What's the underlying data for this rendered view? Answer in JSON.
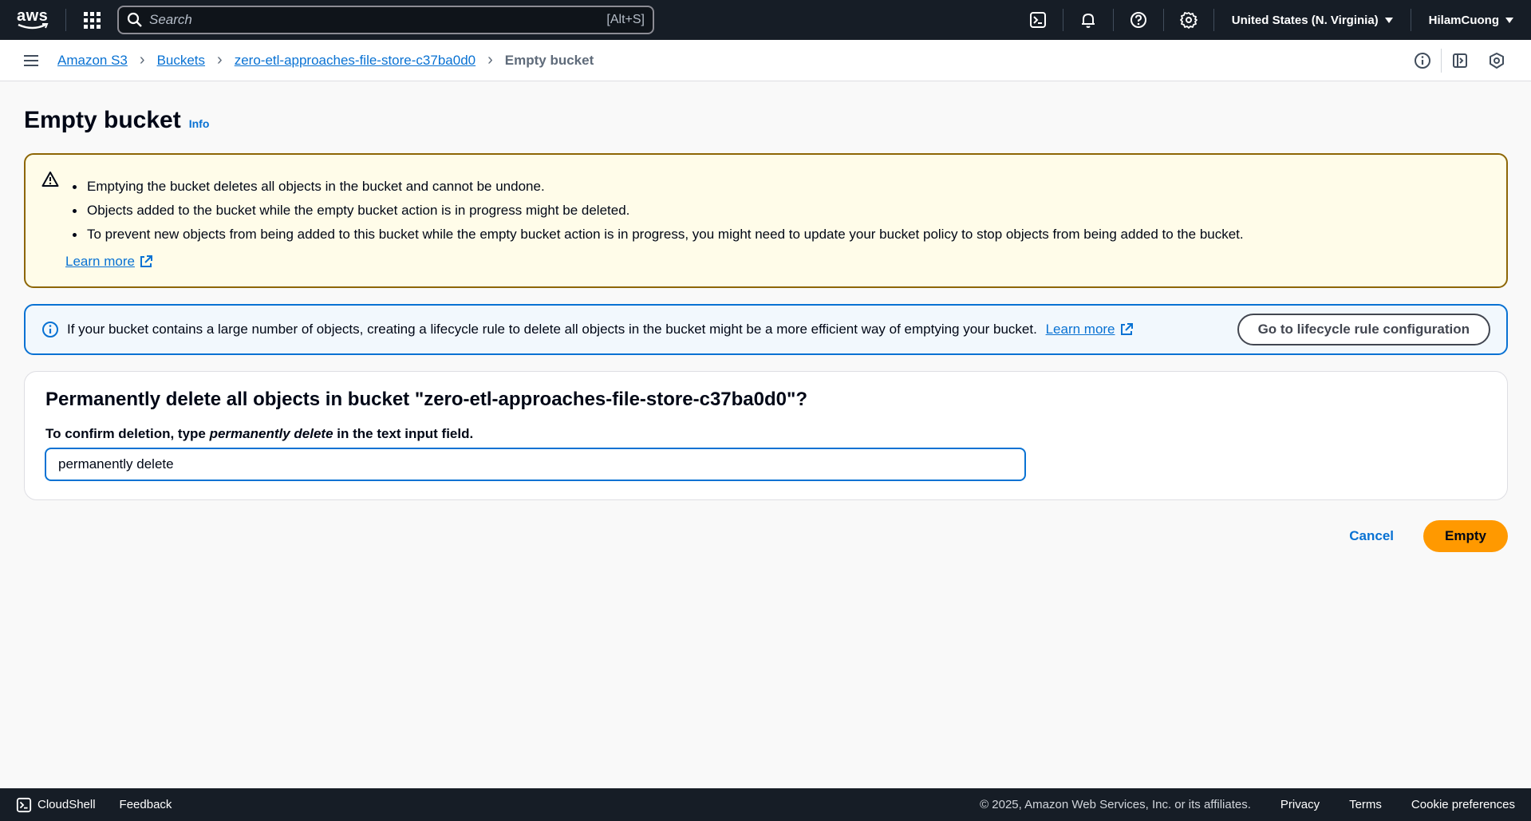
{
  "topnav": {
    "logo_text": "aws",
    "search": {
      "placeholder": "Search",
      "shortcut": "[Alt+S]"
    },
    "region": "United States (N. Virginia)",
    "user": "HilamCuong"
  },
  "breadcrumb": {
    "items": [
      "Amazon S3",
      "Buckets",
      "zero-etl-approaches-file-store-c37ba0d0"
    ],
    "current": "Empty bucket"
  },
  "page": {
    "title": "Empty bucket",
    "info_link": "Info"
  },
  "warning": {
    "bullets": [
      "Emptying the bucket deletes all objects in the bucket and cannot be undone.",
      "Objects added to the bucket while the empty bucket action is in progress might be deleted.",
      "To prevent new objects from being added to this bucket while the empty bucket action is in progress, you might need to update your bucket policy to stop objects from being added to the bucket."
    ],
    "learn_more": "Learn more"
  },
  "info": {
    "text": "If your bucket contains a large number of objects, creating a lifecycle rule to delete all objects in the bucket might be a more efficient way of emptying your bucket.",
    "learn_more": "Learn more",
    "button": "Go to lifecycle rule configuration"
  },
  "confirm": {
    "heading": "Permanently delete all objects in bucket \"zero-etl-approaches-file-store-c37ba0d0\"?",
    "label_prefix": "To confirm deletion, type ",
    "label_emphasis": "permanently delete",
    "label_suffix": " in the text input field.",
    "input_value": "permanently delete"
  },
  "actions": {
    "cancel": "Cancel",
    "empty": "Empty"
  },
  "footer": {
    "cloudshell": "CloudShell",
    "feedback": "Feedback",
    "copyright": "© 2025, Amazon Web Services, Inc. or its affiliates.",
    "privacy": "Privacy",
    "terms": "Terms",
    "cookies": "Cookie preferences"
  },
  "colors": {
    "nav_bg": "#161d26",
    "link": "#0972d3",
    "warning_bg": "#fffce9",
    "warning_border": "#8d6605",
    "info_bg": "#f2f8fd",
    "primary_button": "#ff9900"
  },
  "icons": [
    "aws-logo",
    "apps-grid-icon",
    "search-icon",
    "cloudshell-icon",
    "bell-icon",
    "help-icon",
    "gear-icon",
    "hamburger-icon",
    "chevron-right-icon",
    "info-icon",
    "panel-icon",
    "shield-icon",
    "warning-icon",
    "external-link-icon"
  ]
}
